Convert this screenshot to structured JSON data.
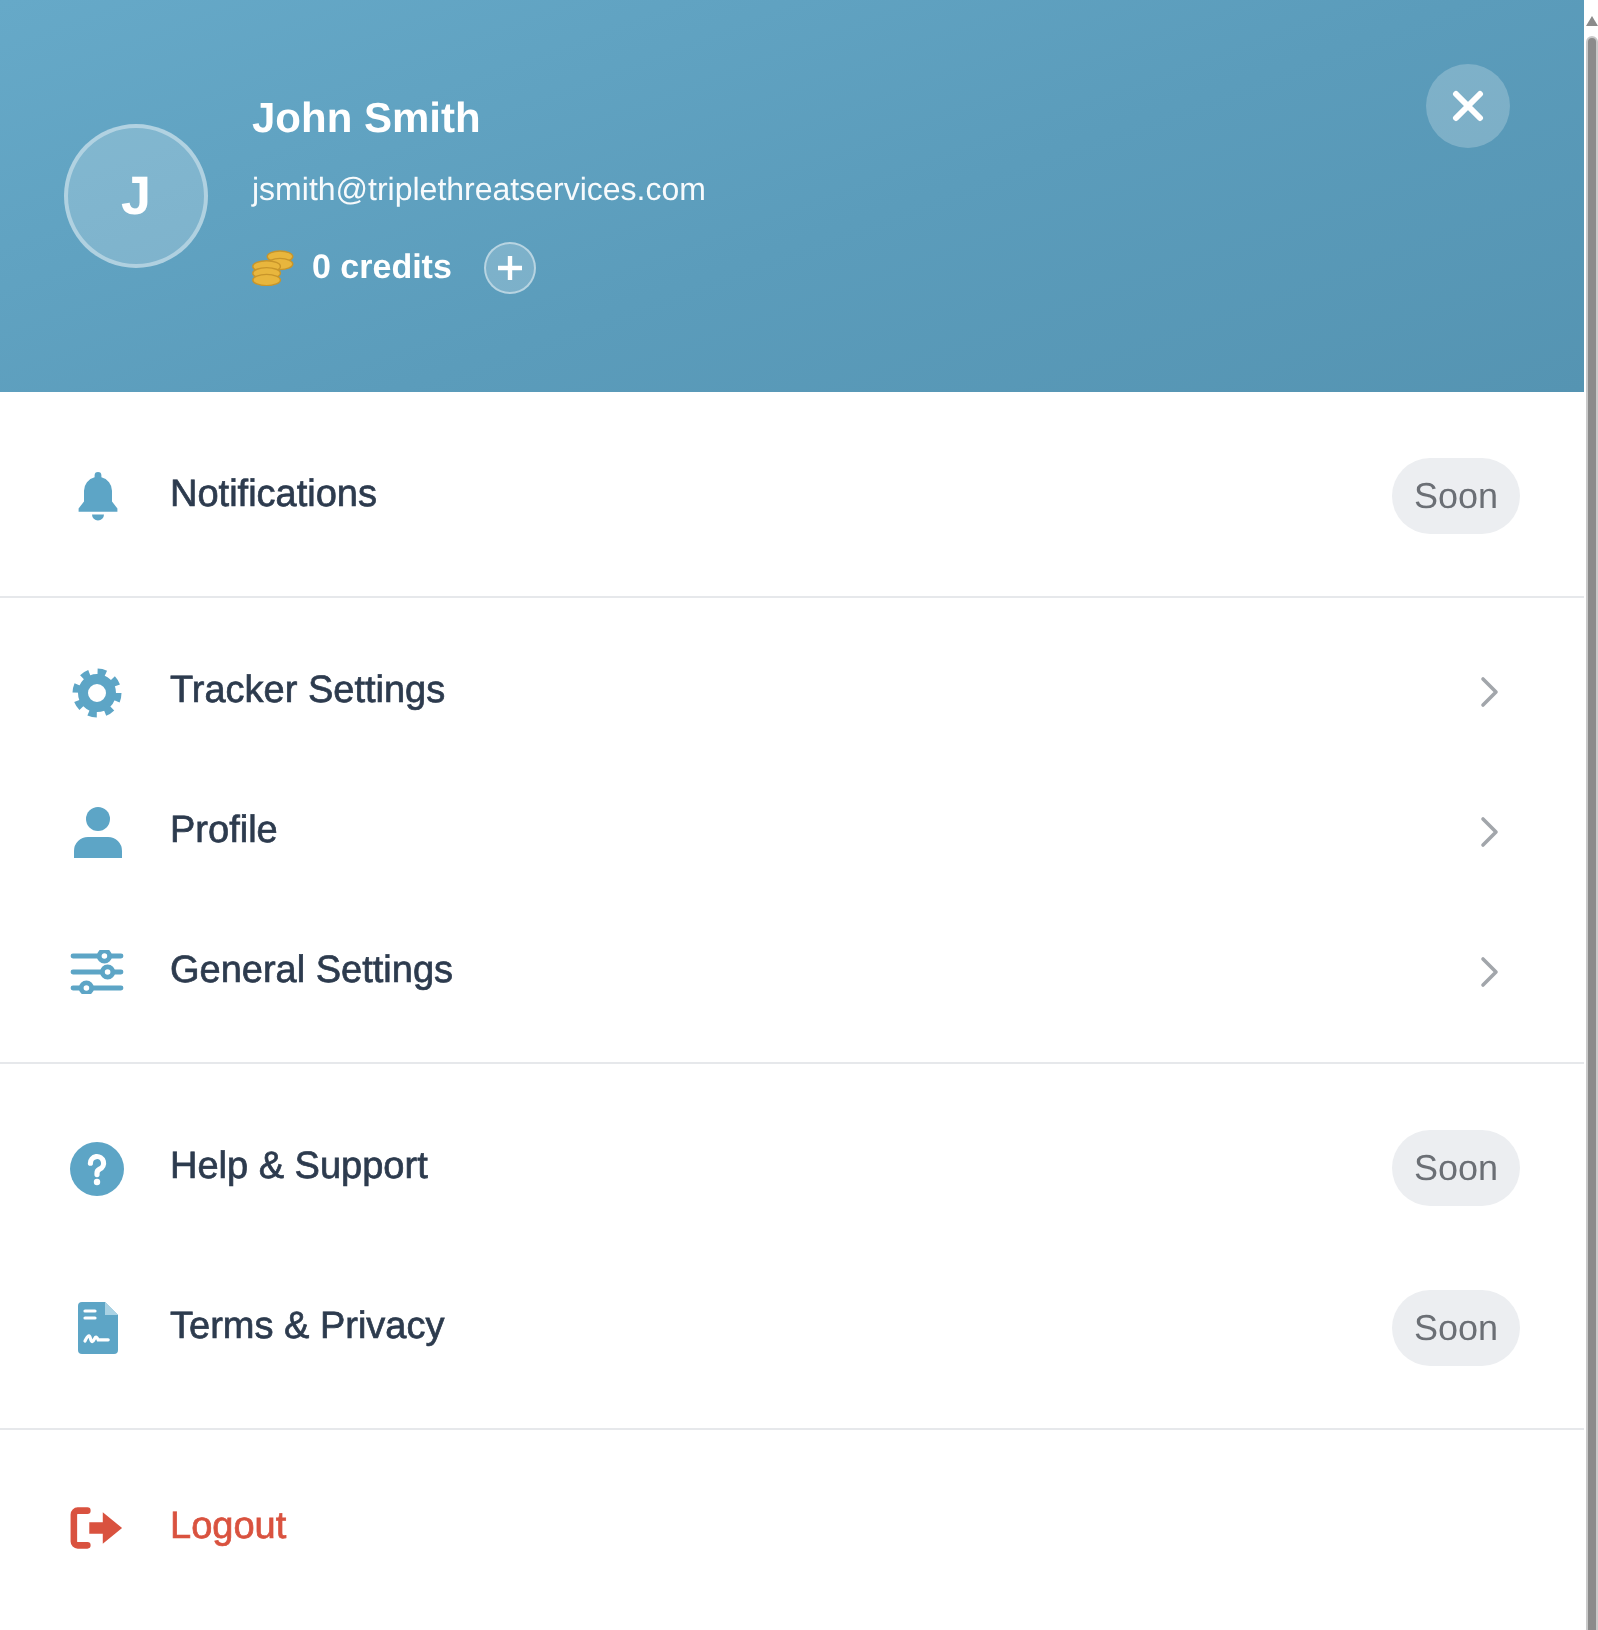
{
  "header": {
    "avatar_initial": "J",
    "name": "John Smith",
    "email": "jsmith@triplethreatservices.com",
    "credits": "0 credits"
  },
  "menu": [
    {
      "items": [
        {
          "label": "Notifications",
          "kind": "badge",
          "badge": "Soon"
        }
      ]
    },
    {
      "items": [
        {
          "label": "Tracker Settings",
          "kind": "chevron"
        },
        {
          "label": "Profile",
          "kind": "chevron"
        },
        {
          "label": "General Settings",
          "kind": "chevron"
        }
      ]
    },
    {
      "items": [
        {
          "label": "Help & Support",
          "kind": "badge",
          "badge": "Soon"
        },
        {
          "label": "Terms & Privacy",
          "kind": "badge",
          "badge": "Soon"
        }
      ]
    },
    {
      "items": [
        {
          "label": "Logout",
          "kind": "danger"
        }
      ]
    }
  ]
}
